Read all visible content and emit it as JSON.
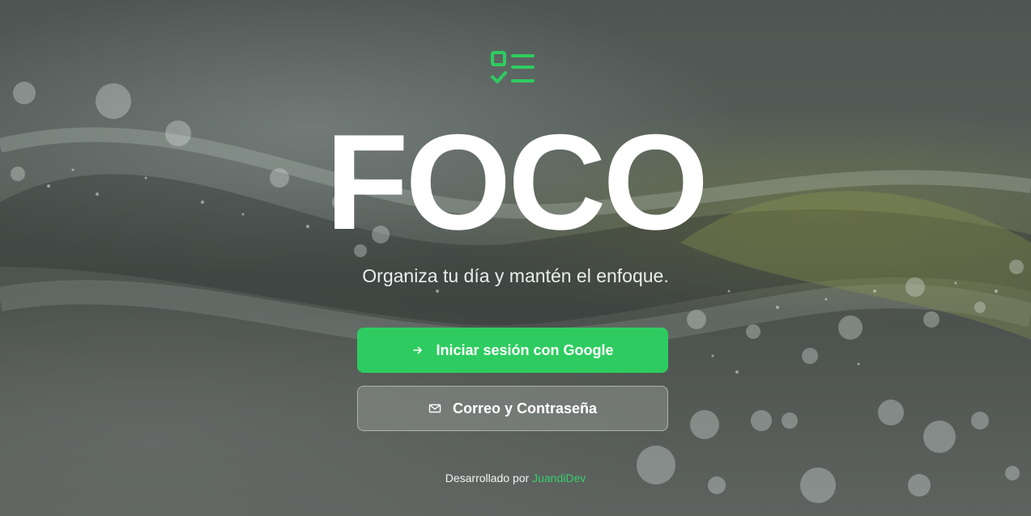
{
  "app": {
    "title": "FOCO",
    "tagline": "Organiza tu día y mantén el enfoque.",
    "logo_icon": "checklist-icon",
    "accent_color": "#2ecc60"
  },
  "actions": {
    "google_label": "Iniciar sesión con Google",
    "google_icon": "arrow-right-icon",
    "email_label": "Correo y Contraseña",
    "email_icon": "mail-icon"
  },
  "footer": {
    "prefix": "Desarrollado por",
    "author": "JuandiDev"
  }
}
